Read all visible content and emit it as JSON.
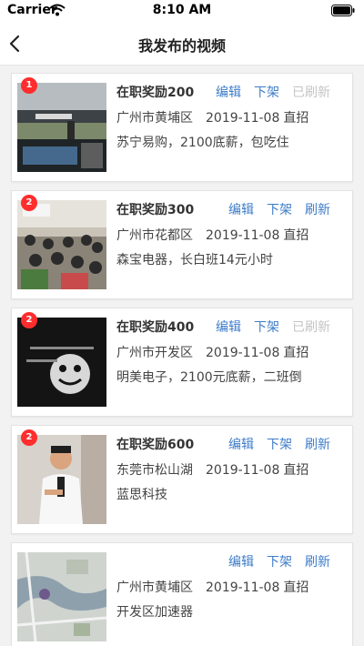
{
  "status": {
    "carrier": "Carrier",
    "time": "8:10 AM"
  },
  "nav": {
    "title": "我发布的视频"
  },
  "actions": {
    "edit": "编辑",
    "off": "下架",
    "refresh": "刷新",
    "refreshed": "已刷新"
  },
  "posts": [
    {
      "badge": "1",
      "reward": "在职奖励200",
      "location": "广州市黄埔区",
      "date": "2019-11-08",
      "type": "直招",
      "desc": "苏宁易购，2100底薪，包吃住",
      "refreshed": true,
      "thumb_icon": "warehouse-photo"
    },
    {
      "badge": "2",
      "reward": "在职奖励300",
      "location": "广州市花都区",
      "date": "2019-11-08",
      "type": "直招",
      "desc": "森宝电器，长白班14元小时",
      "refreshed": false,
      "thumb_icon": "classroom-photo"
    },
    {
      "badge": "2",
      "reward": "在职奖励400",
      "location": "广州市开发区",
      "date": "2019-11-08",
      "type": "直招",
      "desc": "明美电子，2100元底薪，二班倒",
      "refreshed": true,
      "thumb_icon": "dark-poster-photo"
    },
    {
      "badge": "2",
      "reward": "在职奖励600",
      "location": "东莞市松山湖",
      "date": "2019-11-08",
      "type": "直招",
      "desc": "蓝思科技",
      "refreshed": false,
      "thumb_icon": "presenter-photo"
    },
    {
      "badge": "",
      "reward": "",
      "location": "广州市黄埔区",
      "date": "2019-11-08",
      "type": "直招",
      "desc": "开发区加速器",
      "refreshed": false,
      "thumb_icon": "map-photo"
    }
  ]
}
